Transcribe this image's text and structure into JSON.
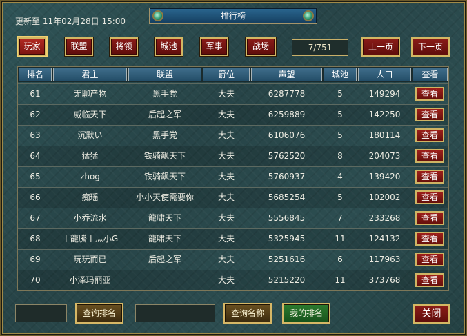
{
  "header": {
    "updated": "更新至 11年02月28日 15:00",
    "title": "排行榜"
  },
  "tabs": [
    {
      "label": "玩家",
      "active": true
    },
    {
      "label": "联盟",
      "active": false
    },
    {
      "label": "将领",
      "active": false
    },
    {
      "label": "城池",
      "active": false
    },
    {
      "label": "军事",
      "active": false
    },
    {
      "label": "战场",
      "active": false
    }
  ],
  "pager": {
    "page": "7/751",
    "prev_label": "上一页",
    "next_label": "下一页"
  },
  "table": {
    "columns": [
      "排名",
      "君主",
      "联盟",
      "爵位",
      "声望",
      "城池",
      "人口",
      "查看"
    ],
    "view_label": "查看",
    "rows": [
      {
        "rank": "61",
        "lord": "无聊产物",
        "alliance": "黑手党",
        "title": "大夫",
        "fame": "6287778",
        "cities": "5",
        "population": "149294"
      },
      {
        "rank": "62",
        "lord": "威临天下",
        "alliance": "后起之军",
        "title": "大夫",
        "fame": "6259889",
        "cities": "5",
        "population": "142250"
      },
      {
        "rank": "63",
        "lord": "沉默い",
        "alliance": "黑手党",
        "title": "大夫",
        "fame": "6106076",
        "cities": "5",
        "population": "180114"
      },
      {
        "rank": "64",
        "lord": "猛猛",
        "alliance": "铁骑飙天下",
        "title": "大夫",
        "fame": "5762520",
        "cities": "8",
        "population": "204073"
      },
      {
        "rank": "65",
        "lord": "zhog",
        "alliance": "铁骑飙天下",
        "title": "大夫",
        "fame": "5760937",
        "cities": "4",
        "population": "139420"
      },
      {
        "rank": "66",
        "lord": "痴瑶",
        "alliance": "小小天使需要你",
        "title": "大夫",
        "fame": "5685254",
        "cities": "5",
        "population": "102002"
      },
      {
        "rank": "67",
        "lord": "小乔流水",
        "alliance": "龍啸天下",
        "title": "大夫",
        "fame": "5556845",
        "cities": "7",
        "population": "233268"
      },
      {
        "rank": "68",
        "lord": "丨龍騰丨灬小G",
        "alliance": "龍啸天下",
        "title": "大夫",
        "fame": "5325945",
        "cities": "11",
        "population": "124132"
      },
      {
        "rank": "69",
        "lord": "玩玩而已",
        "alliance": "后起之军",
        "title": "大夫",
        "fame": "5251616",
        "cities": "6",
        "population": "117963"
      },
      {
        "rank": "70",
        "lord": "小泽玛丽亚",
        "alliance": "",
        "title": "大夫",
        "fame": "5215220",
        "cities": "11",
        "population": "373768"
      }
    ]
  },
  "footer": {
    "rank_query_value": "",
    "rank_query_label": "查询排名",
    "name_query_value": "",
    "name_query_label": "查询名称",
    "my_rank_label": "我的排名",
    "close_label": "关闭"
  },
  "colors": {
    "panel_bg": "#2c4d50",
    "header_blue": "#2a6790",
    "button_red": "#8b1c18",
    "gold_border": "#d3b763"
  }
}
